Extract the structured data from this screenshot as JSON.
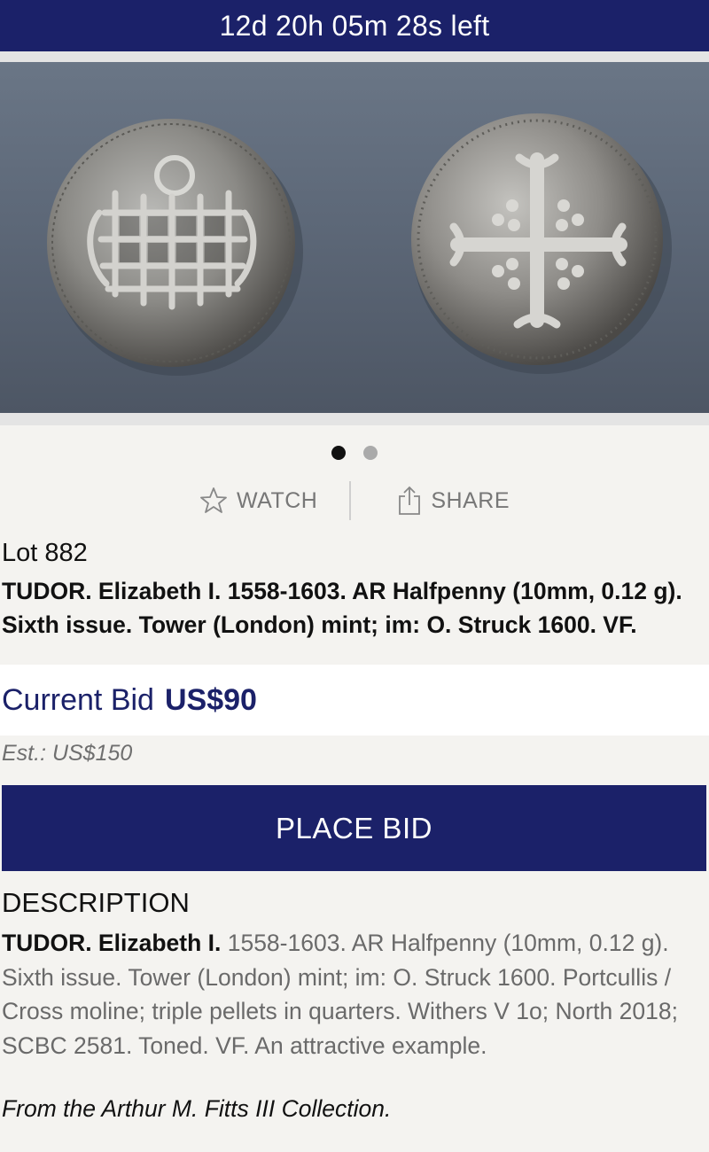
{
  "timer": {
    "text": "12d 20h 05m 28s left"
  },
  "gallery": {
    "images": [
      "obverse-portcullis",
      "reverse-cross-moline"
    ],
    "active_index": 0,
    "background_color": "#5f6a7a"
  },
  "actions": {
    "watch_label": "WATCH",
    "watch_icon": "star-outline-icon",
    "share_label": "SHARE",
    "share_icon": "share-icon"
  },
  "lot": {
    "number": "Lot 882",
    "title": "TUDOR. Elizabeth I. 1558-1603. AR Halfpenny (10mm, 0.12 g). Sixth issue. Tower (London) mint; im: O. Struck 1600. VF."
  },
  "bid": {
    "label": "Current Bid",
    "amount": "US$90",
    "estimate": "Est.: US$150",
    "button_label": "PLACE BID"
  },
  "description": {
    "heading": "DESCRIPTION",
    "lead": "TUDOR. Elizabeth I.",
    "body": " 1558-1603. AR Halfpenny (10mm, 0.12 g). Sixth issue. Tower (London) mint; im: O. Struck 1600. Portcullis / Cross moline; triple pellets in quarters. Withers V 1o; North 2018; SCBC 2581. Toned. VF. An attractive example.",
    "provenance": "From the Arthur M. Fitts III Collection."
  },
  "colors": {
    "brand_navy": "#1b2169",
    "page_bg": "#f4f3f0",
    "muted_text": "#6a6a6a"
  }
}
